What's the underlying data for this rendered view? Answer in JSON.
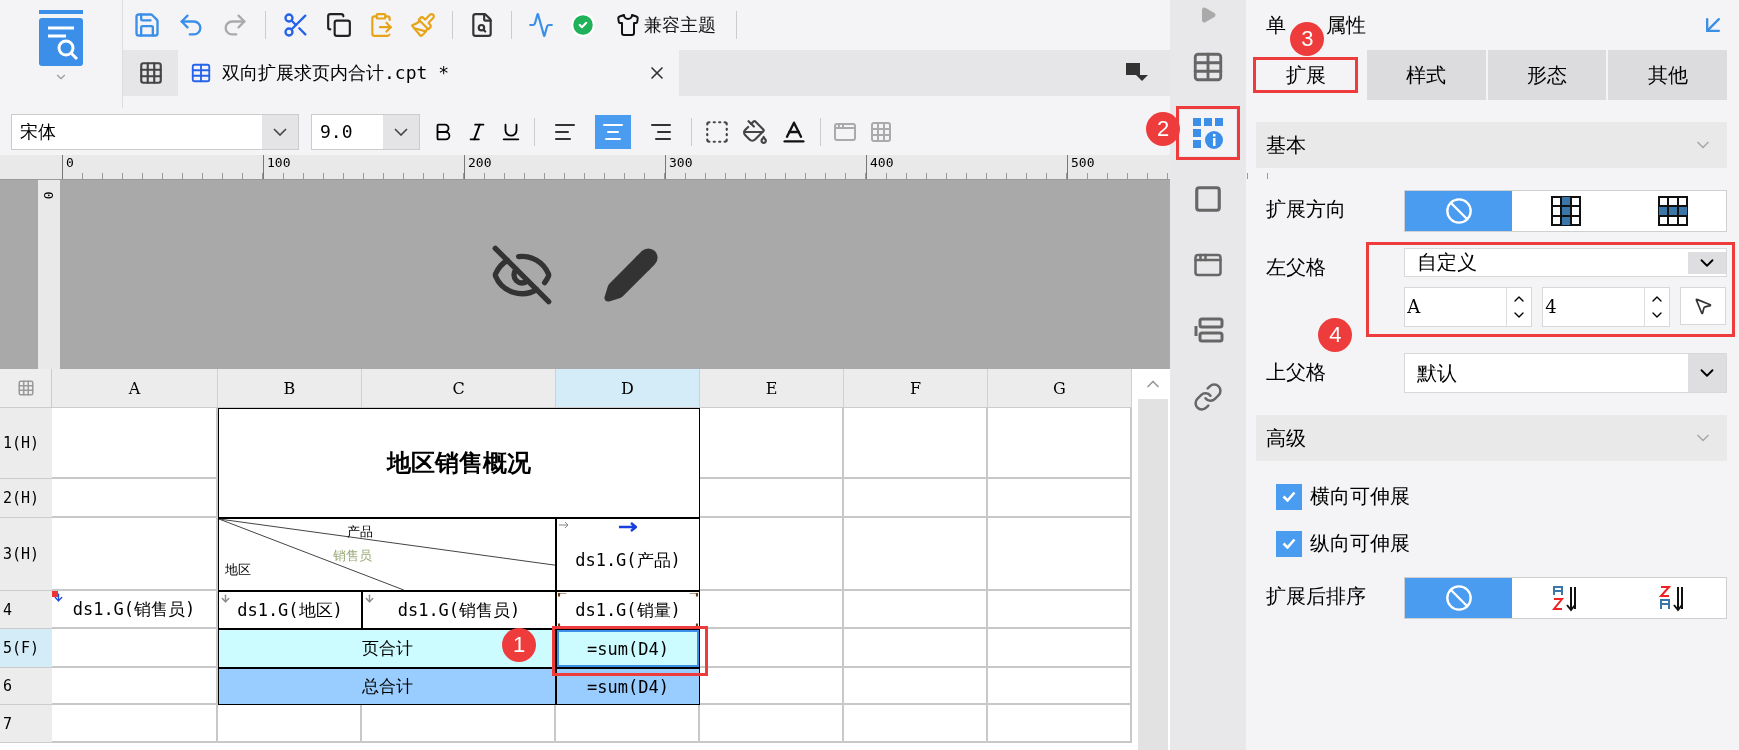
{
  "toolbar": {
    "theme_button": "兼容主题"
  },
  "document_tab": {
    "title": "双向扩展求页内合计.cpt *"
  },
  "format_bar": {
    "font": "宋体",
    "size": "9.0",
    "alignment": [
      {
        "kind": "left",
        "selected": false
      },
      {
        "kind": "center",
        "selected": true
      },
      {
        "kind": "right",
        "selected": false
      }
    ]
  },
  "ruler": {
    "horizontal_ticks": [
      "0",
      "100",
      "200",
      "300",
      "400",
      "500"
    ],
    "vertical_ticks": [
      "0"
    ]
  },
  "sheet": {
    "callout": "1",
    "columns": [
      {
        "label": "A",
        "selected": false
      },
      {
        "label": "B",
        "selected": false
      },
      {
        "label": "C",
        "selected": false
      },
      {
        "label": "D",
        "selected": true
      },
      {
        "label": "E",
        "selected": false
      },
      {
        "label": "F",
        "selected": false
      },
      {
        "label": "G",
        "selected": false
      }
    ],
    "rows": [
      {
        "label": "1(H)",
        "selected": false,
        "cells": [
          {
            "kind": "empty"
          },
          {
            "kind": "title",
            "text": "地区销售概况"
          }
        ]
      },
      {
        "label": "2(H)",
        "selected": false,
        "cells": [
          {
            "kind": "empty"
          }
        ]
      },
      {
        "label": "3(H)",
        "selected": false,
        "cells": [
          {
            "kind": "empty"
          },
          {
            "kind": "diagonal",
            "labels": [
              "产品",
              "销售员",
              "地区"
            ]
          },
          {
            "kind": "field_right",
            "text": "ds1.G(产品)"
          }
        ]
      },
      {
        "label": "4",
        "selected": false,
        "cells": [
          {
            "kind": "field_down",
            "custom_parent": true,
            "text": "ds1.G(销售员)"
          },
          {
            "kind": "field_down",
            "text": "ds1.G(地区)"
          },
          {
            "kind": "field_down",
            "text": "ds1.G(销售员)"
          },
          {
            "kind": "field",
            "text": "ds1.G(销量)"
          }
        ]
      },
      {
        "label": "5(F)",
        "selected": true,
        "cells": [
          {
            "kind": "empty"
          },
          {
            "kind": "page_total_label",
            "text": "页合计"
          },
          {
            "kind": "page_total_value",
            "selected": true,
            "text": "=sum(D4)"
          }
        ]
      },
      {
        "label": "6",
        "selected": false,
        "cells": [
          {
            "kind": "empty"
          },
          {
            "kind": "grand_total_label",
            "text": "总合计"
          },
          {
            "kind": "grand_total_value",
            "selected": false,
            "text": "=sum(D4)"
          }
        ]
      },
      {
        "label": "7",
        "selected": false,
        "cells": []
      }
    ]
  },
  "side_icons": {
    "callout": "2",
    "items": [
      {
        "kind": "layout",
        "selected": false
      },
      {
        "kind": "cell",
        "selected": true
      },
      {
        "kind": "frame",
        "selected": false
      },
      {
        "kind": "widget",
        "selected": false
      },
      {
        "kind": "stack",
        "selected": false
      },
      {
        "kind": "link",
        "selected": false
      }
    ]
  },
  "properties": {
    "title_parts": [
      "单",
      "属性"
    ],
    "callout": "3",
    "tabs": [
      {
        "label": "扩展",
        "selected": true
      },
      {
        "label": "样式",
        "selected": false
      },
      {
        "label": "形态",
        "selected": false
      },
      {
        "label": "其他",
        "selected": false
      }
    ],
    "basic": {
      "title": "基本",
      "expanded": true
    },
    "expand_direction": {
      "label": "扩展方向",
      "options": [
        {
          "kind": "none",
          "selected": true
        },
        {
          "kind": "vertical",
          "selected": false
        },
        {
          "kind": "horizontal",
          "selected": false
        }
      ]
    },
    "left_parent": {
      "label": "左父格",
      "value": "自定义",
      "column": "A",
      "row": "4",
      "callout": "4"
    },
    "top_parent": {
      "label": "上父格",
      "value": "默认"
    },
    "advanced": {
      "title": "高级",
      "expanded": true
    },
    "checkboxes": [
      {
        "label": "横向可伸展",
        "checked": true
      },
      {
        "label": "纵向可伸展",
        "checked": true
      }
    ],
    "sort": {
      "label": "扩展后排序",
      "options": [
        {
          "kind": "none",
          "selected": true
        },
        {
          "kind": "ascending",
          "selected": false
        },
        {
          "kind": "descending",
          "selected": false
        }
      ]
    }
  }
}
